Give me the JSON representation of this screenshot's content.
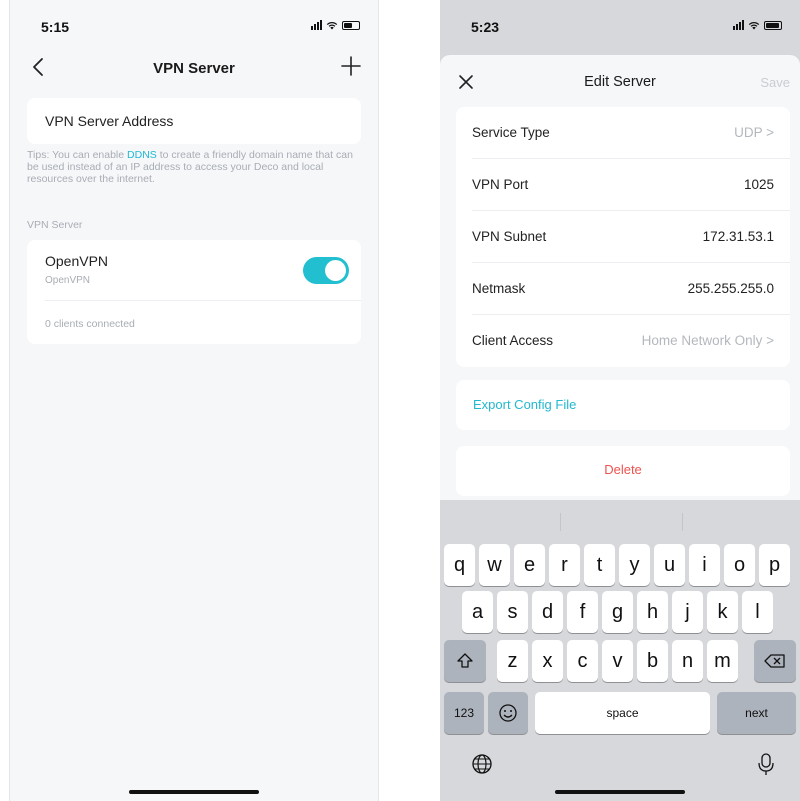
{
  "left": {
    "status": {
      "time": "5:15"
    },
    "nav": {
      "title": "VPN Server"
    },
    "address": {
      "label": "VPN Server Address"
    },
    "tips": {
      "prefix": "Tips: You can enable ",
      "link": "DDNS",
      "suffix": " to create a friendly domain name that can be used instead of an IP address to access your Deco and local resources over the internet."
    },
    "section": {
      "label": "VPN Server"
    },
    "vpn": {
      "name": "OpenVPN",
      "subtitle": "OpenVPN",
      "enabled": true,
      "clients": "0 clients connected"
    }
  },
  "right": {
    "status": {
      "time": "5:23"
    },
    "sheet": {
      "title": "Edit Server",
      "save_label": "Save",
      "rows": [
        {
          "label": "Service Type",
          "value": "UDP >"
        },
        {
          "label": "VPN Port",
          "value": "1025"
        },
        {
          "label": "VPN Subnet",
          "value": "172.31.53.1"
        },
        {
          "label": "Netmask",
          "value": "255.255.255.0"
        },
        {
          "label": "Client Access",
          "value": "Home Network Only >"
        }
      ],
      "export_label": "Export Config File",
      "delete_label": "Delete"
    },
    "keyboard": {
      "row1": [
        "q",
        "w",
        "e",
        "r",
        "t",
        "y",
        "u",
        "i",
        "o",
        "p"
      ],
      "row2": [
        "a",
        "s",
        "d",
        "f",
        "g",
        "h",
        "j",
        "k",
        "l"
      ],
      "row3": [
        "z",
        "x",
        "c",
        "v",
        "b",
        "n",
        "m"
      ],
      "numbers_key": "123",
      "space_key": "space",
      "next_key": "next"
    }
  },
  "colors": {
    "accent": "#22bfd0",
    "danger": "#ef5350",
    "muted": "#a8adb4"
  }
}
